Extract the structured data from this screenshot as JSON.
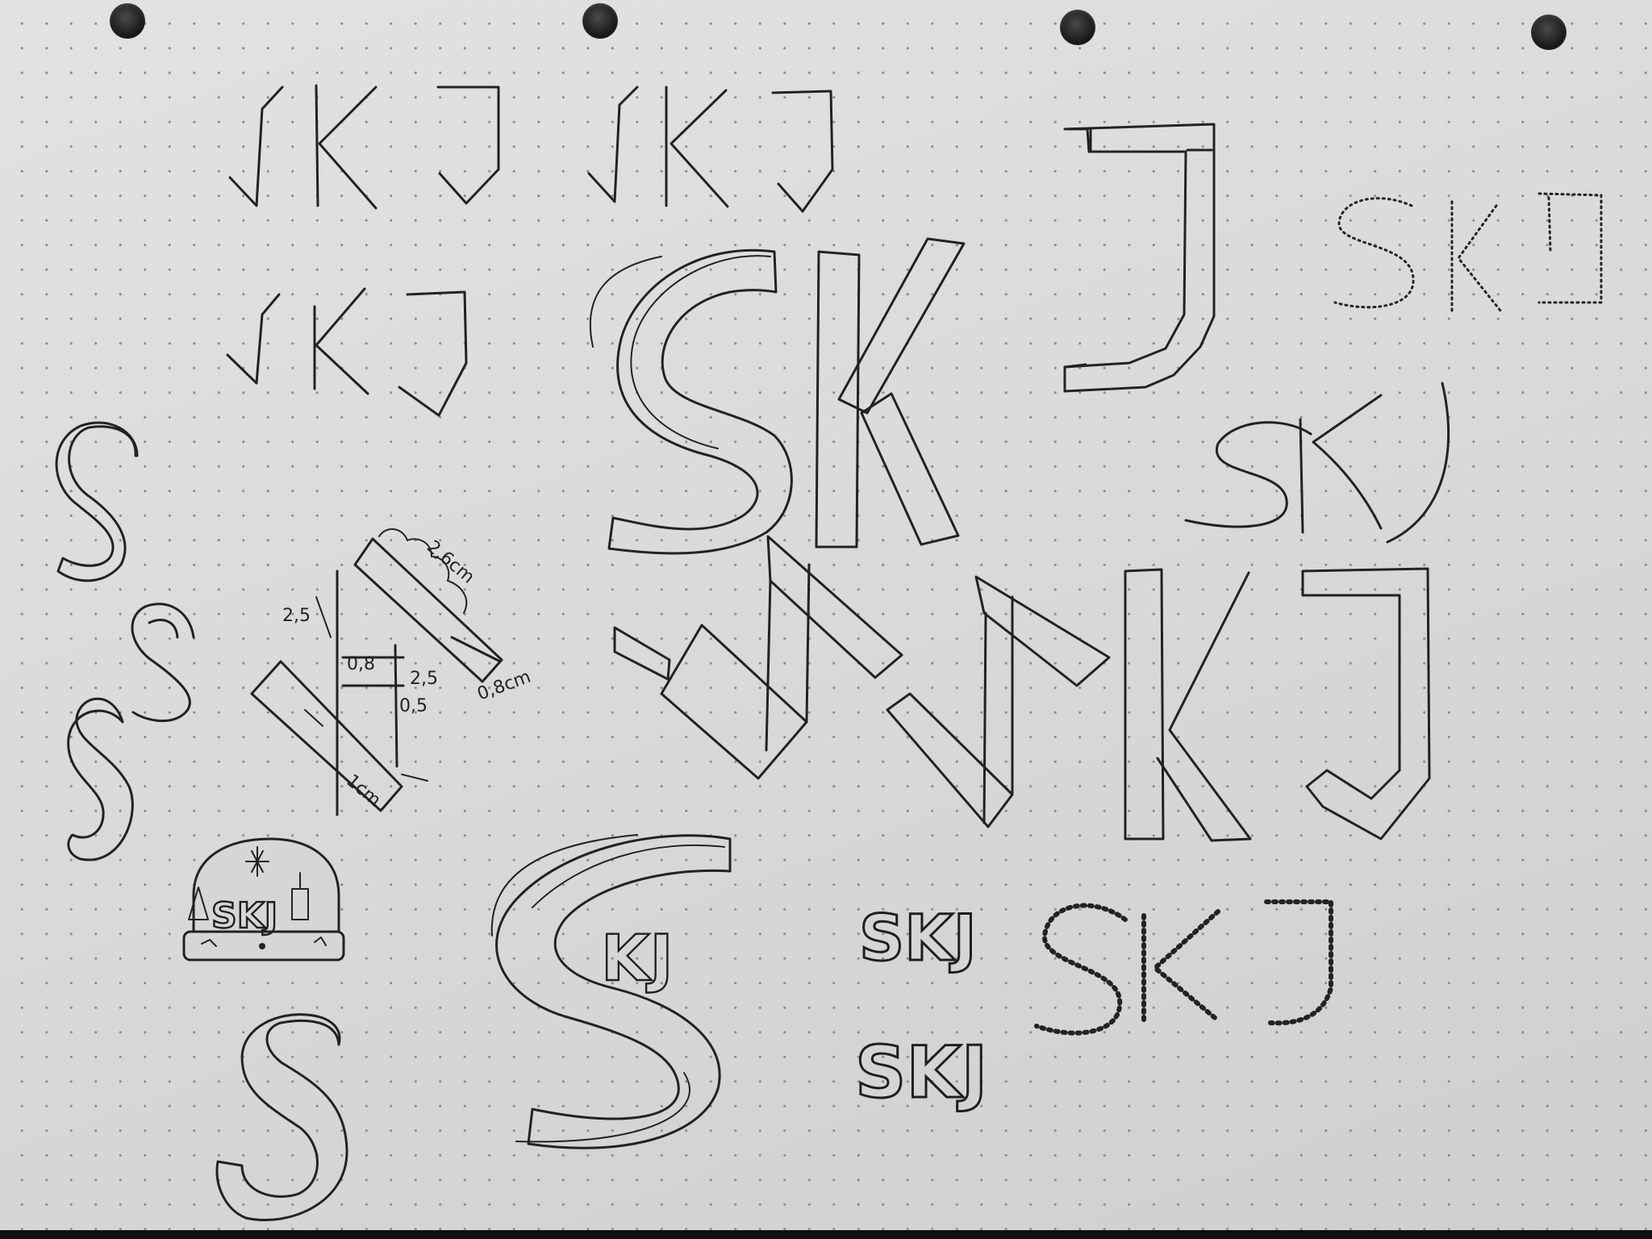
{
  "photo": {
    "subject": "SKJ",
    "colors": {
      "paper": "#dcdddb",
      "ink": "#222222",
      "dots": "#8d8e8c",
      "background": "#1a1a1a"
    }
  },
  "annotations": {
    "a_26cm": "2,6cm",
    "a_25_left": "2,5",
    "a_08_inner": "0,8",
    "a_25_mid": "2,5",
    "a_05": "0,5",
    "a_08cm": "0,8cm",
    "a_1cm": "1cm"
  },
  "sketches": {
    "hat_label": "SKJ",
    "small_skj_1": "SKJ",
    "small_skj_2": "SKJ",
    "sk_overlay": "KJ"
  }
}
